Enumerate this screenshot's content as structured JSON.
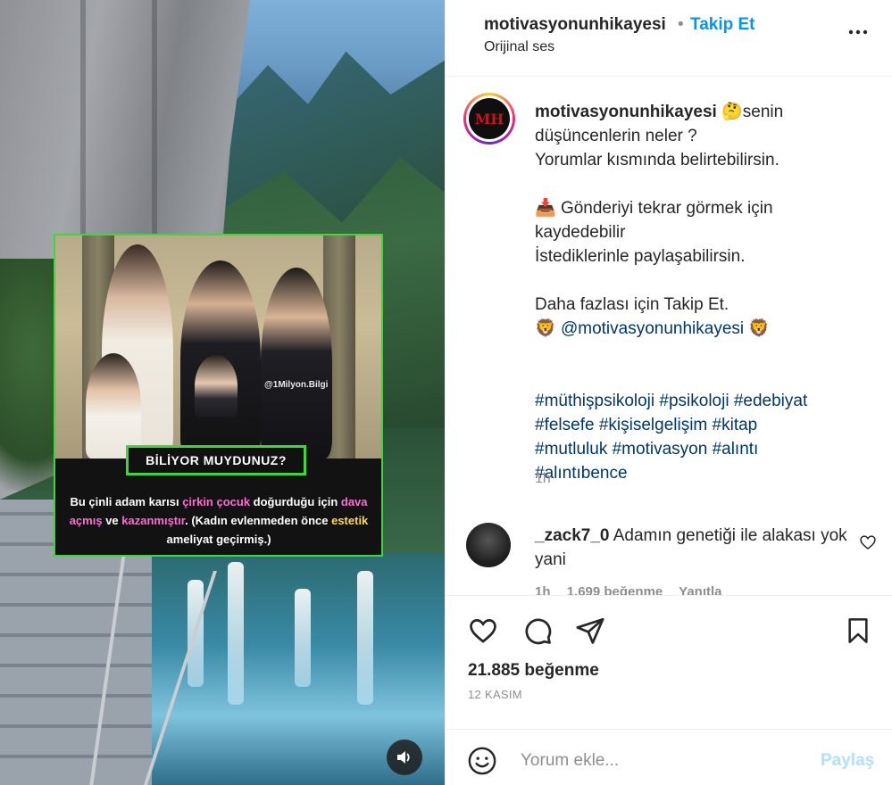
{
  "media": {
    "watermark": "@1Milyon.Bilgi",
    "badge": "BİLİYOR MUYDUNUZ?",
    "fact": {
      "part1": "Bu çinli adam karısı ",
      "hl1": "çirkin çocuk",
      "part2": " doğurduğu için ",
      "hl2": "dava açmış",
      "part3": " ve ",
      "hl3": "kazanmıştır",
      "part4": ". (Kadın evlenmeden önce ",
      "hl4": "estetik",
      "part5": " ameliyat geçirmiş.)"
    },
    "sound_icon": "speaker-icon"
  },
  "header": {
    "username": "motivasyonunhikayesi",
    "dot": "•",
    "follow_label": "Takip Et",
    "audio": "Orijinal ses",
    "more_icon": "more-icon"
  },
  "post": {
    "avatar_text": "MH",
    "username": "motivasyonunhikayesi",
    "emoji1": "🤔",
    "line1": "senin düşüncenlerin neler ?\nYorumlar kısmında belirtebilirsin.",
    "emoji2": "📥",
    "line2": "Gönderiyi tekrar görmek için kaydedebilir\nİstediklerinle paylaşabilirsin.",
    "line3": "Daha fazlası için Takip Et.",
    "emoji3": "🦁",
    "mention": "@motivasyonunhikayesi",
    "tags": [
      "#müthişpsikoloji",
      "#psikoloji",
      "#edebiyat",
      "#felsefe",
      "#kişiselgelişim",
      "#kitap",
      "#mutluluk",
      "#motivasyon",
      "#alıntı",
      "#alıntıbence"
    ],
    "time": "1h"
  },
  "comment": {
    "username": "_zack7_0",
    "text": "Adamın genetiği ile alakası yok yani",
    "time": "1h",
    "likes": "1.699 beğenme",
    "reply": "Yanıtla"
  },
  "actions": {
    "likes": "21.885 beğenme",
    "date": "12 KASIM"
  },
  "composer": {
    "placeholder": "Yorum ekle...",
    "post_label": "Paylaş"
  },
  "colors": {
    "accent": "#0095f6",
    "card_border": "#3ad83a",
    "highlight_pink": "#ff6bd6",
    "highlight_yellow": "#ffd84a"
  }
}
